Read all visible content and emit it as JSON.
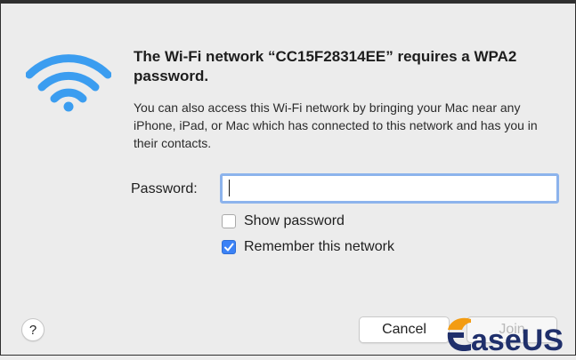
{
  "dialog": {
    "title": "The Wi-Fi network “CC15F28314EE” requires a WPA2 password.",
    "body": "You can also access this Wi-Fi network by bringing your Mac near any iPhone, iPad, or Mac which has connected to this network and has you in their contacts.",
    "password": {
      "label": "Password:",
      "value": ""
    },
    "options": [
      {
        "label": "Show password",
        "checked": false
      },
      {
        "label": "Remember this network",
        "checked": true
      }
    ],
    "buttons": {
      "help_label": "?",
      "cancel_label": "Cancel",
      "join_label": "Join"
    }
  },
  "icons": {
    "wifi": "wifi-icon",
    "checkmark": "checkmark-icon"
  },
  "colors": {
    "wifi_blue": "#3b9df0",
    "checkbox_blue": "#3b82f6",
    "focus_ring": "#8cb3ec",
    "watermark_navy": "#1f2f6b",
    "watermark_orange": "#f39c12"
  },
  "watermark": {
    "brand_text": "aseUS"
  }
}
